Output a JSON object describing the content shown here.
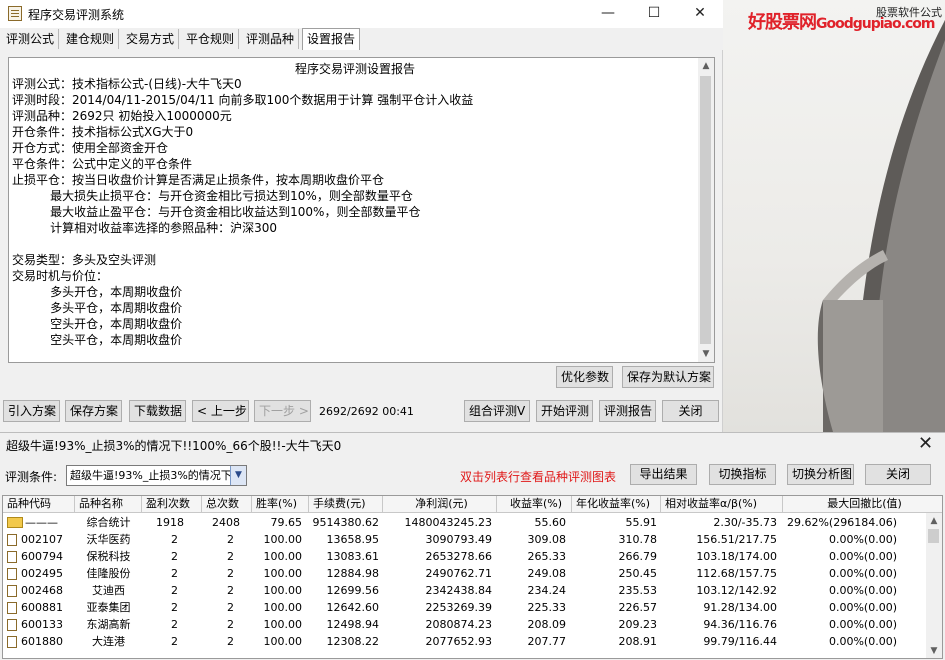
{
  "window": {
    "title": "程序交易评测系统",
    "controls": {
      "minimize": "—",
      "maximize": "☐",
      "close": "✕"
    }
  },
  "watermark": {
    "brand": "好股票网",
    "brand_en": "Goodgupiao.com",
    "small": "股票软件公式"
  },
  "tabs": [
    "评测公式",
    "建仓规则",
    "交易方式",
    "平仓规则",
    "评测品种",
    "设置报告"
  ],
  "report": {
    "title": "程序交易评测设置报告",
    "lines": [
      "评测公式：技术指标公式-(日线)-大牛飞天0",
      "评测时段：2014/04/11-2015/04/11 向前多取100个数据用于计算 强制平仓计入收益",
      "评测品种：2692只 初始投入1000000元",
      "开仓条件：技术指标公式XG大于0",
      "开仓方式：使用全部资金开仓",
      "平仓条件：公式中定义的平仓条件",
      "止损平仓：按当日收盘价计算是否满足止损条件，按本周期收盘价平仓",
      "          最大损失止损平仓：与开仓资金相比亏损达到10%，则全部数量平仓",
      "          最大收益止盈平仓：与开仓资金相比收益达到100%，则全部数量平仓",
      "          计算相对收益率选择的参照品种：沪深300",
      "",
      "交易类型：多头及空头评测",
      "交易时机与价位：",
      "          多头开仓，本周期收盘价",
      "          多头平仓，本周期收盘价",
      "          空头开仓，本周期收盘价",
      "          空头平仓，本周期收盘价"
    ]
  },
  "buttons": {
    "optimize": "优化参数",
    "save_default": "保存为默认方案",
    "import": "引入方案",
    "save": "保存方案",
    "download": "下载数据",
    "prev": "< 上一步",
    "next": "下一步 >",
    "combo": "组合评测V",
    "start": "开始评测",
    "report": "评测报告",
    "close": "关闭"
  },
  "progress_text": "2692/2692 00:41",
  "results": {
    "title": "超级牛逼!93%_止损3%的情况下!!100%_66个股!!-大牛飞天0",
    "close_icon": "✕",
    "condition_label": "评测条件:",
    "condition_value": "超级牛逼!93%_止损3%的情况下",
    "hint": "双击列表行查看品种评测图表",
    "export": "导出结果",
    "switch_indicator": "切换指标",
    "switch_chart": "切换分析图",
    "close": "关闭",
    "columns": [
      "品种代码",
      "品种名称",
      "盈利次数",
      "总次数",
      "胜率(%)",
      "手续费(元)",
      "净利润(元)",
      "收益率(%)",
      "年化收益率(%)",
      "相对收益率α/β(%)",
      "最大回撤比(值)"
    ],
    "rows": [
      [
        "———",
        "综合统计",
        "1918",
        "2408",
        "79.65",
        "9514380.62",
        "1480043245.23",
        "55.60",
        "55.91",
        "2.30/-35.73",
        "29.62%(296184.06)"
      ],
      [
        "002107",
        "沃华医药",
        "2",
        "2",
        "100.00",
        "13658.95",
        "3090793.49",
        "309.08",
        "310.78",
        "156.51/217.75",
        "0.00%(0.00)"
      ],
      [
        "600794",
        "保税科技",
        "2",
        "2",
        "100.00",
        "13083.61",
        "2653278.66",
        "265.33",
        "266.79",
        "103.18/174.00",
        "0.00%(0.00)"
      ],
      [
        "002495",
        "佳隆股份",
        "2",
        "2",
        "100.00",
        "12884.98",
        "2490762.71",
        "249.08",
        "250.45",
        "112.68/157.75",
        "0.00%(0.00)"
      ],
      [
        "002468",
        "艾迪西",
        "2",
        "2",
        "100.00",
        "12699.56",
        "2342438.84",
        "234.24",
        "235.53",
        "103.12/142.92",
        "0.00%(0.00)"
      ],
      [
        "600881",
        "亚泰集团",
        "2",
        "2",
        "100.00",
        "12642.60",
        "2253269.39",
        "225.33",
        "226.57",
        "91.28/134.00",
        "0.00%(0.00)"
      ],
      [
        "600133",
        "东湖高新",
        "2",
        "2",
        "100.00",
        "12498.94",
        "2080874.23",
        "208.09",
        "209.23",
        "94.36/116.76",
        "0.00%(0.00)"
      ],
      [
        "601880",
        "大连港",
        "2",
        "2",
        "100.00",
        "12308.22",
        "2077652.93",
        "207.77",
        "208.91",
        "99.79/116.44",
        "0.00%(0.00)"
      ]
    ]
  }
}
